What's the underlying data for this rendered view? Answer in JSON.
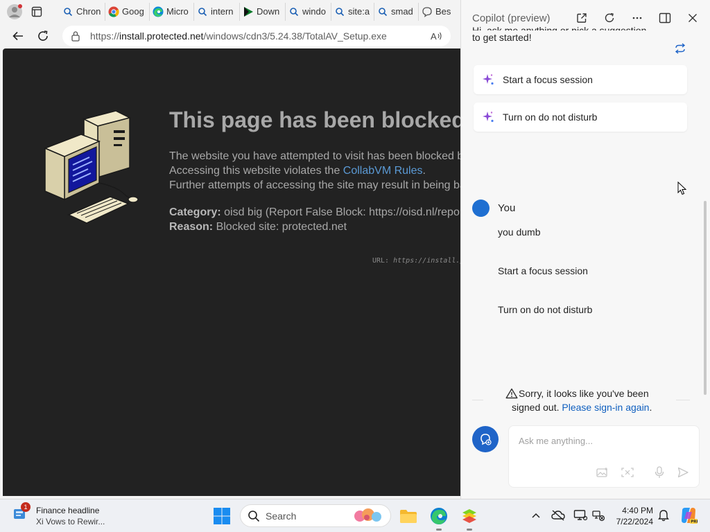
{
  "tabs": [
    {
      "label": "Chron",
      "icon": "search-icon"
    },
    {
      "label": "Goog",
      "icon": "chrome-icon"
    },
    {
      "label": "Micro",
      "icon": "edge-icon"
    },
    {
      "label": "intern",
      "icon": "search-icon"
    },
    {
      "label": "Down",
      "icon": "play-icon"
    },
    {
      "label": "windo",
      "icon": "search-icon"
    },
    {
      "label": "site:a",
      "icon": "search-icon"
    },
    {
      "label": "smad",
      "icon": "search-icon"
    },
    {
      "label": "Bes",
      "icon": "chat-icon"
    }
  ],
  "address": {
    "url_prefix": "https://",
    "url_host": "install.protected.net",
    "url_path": "/windows/cdn3/5.24.38/TotalAV_Setup.exe"
  },
  "blocked": {
    "title": "This page has been blocked",
    "line1": "The website you have attempted to visit has been blocked b",
    "line2_pre": "Accessing this website violates the ",
    "line2_link": "CollabVM Rules",
    "line2_post": ".",
    "line3": "Further attempts of accessing the site may result in being ba",
    "category_label": "Category:",
    "category_value": " oisd big (Report False Block: https://oisd.nl/repor",
    "reason_label": "Reason:",
    "reason_value": " Blocked site: protected.net",
    "url_label": "URL: ",
    "url_value": "https://install.p"
  },
  "copilot": {
    "title": "Copilot (preview)",
    "intro_partial": "Hi, ask me anything or pick a suggestion",
    "intro_line2": "to get started!",
    "suggestions": [
      "Start a focus session",
      "Turn on do not disturb"
    ],
    "user_name": "You",
    "messages": [
      "you dumb",
      "Start a focus session",
      "Turn on do not disturb"
    ],
    "warning_l1": "Sorry, it looks like you've been",
    "warning_l2_pre": "signed out. ",
    "warning_link": "Please sign-in again",
    "warning_l2_post": ".",
    "input_placeholder": "Ask me anything..."
  },
  "taskbar": {
    "news_badge": "1",
    "news_title": "Finance headline",
    "news_sub": "Xi Vows to Rewir...",
    "search_label": "Search",
    "time": "4:40 PM",
    "date": "7/22/2024"
  },
  "colors": {
    "page_bg": "#222222",
    "link_blue": "#5b9ad5",
    "copilot_accent": "#1f64c8"
  }
}
